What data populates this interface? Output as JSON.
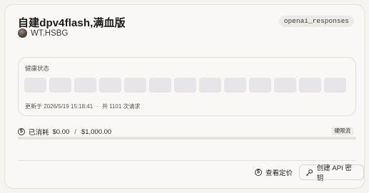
{
  "card": {
    "title": "自建dpv4flash,满血版",
    "tag": "openai_responses",
    "owner": "WT.HSBG"
  },
  "health": {
    "label": "健康状态",
    "bar_count": 13,
    "updated_label": "更新于 2026/5/19 15:18:41",
    "separator": "·",
    "request_summary": "共 1101 次请求"
  },
  "spend": {
    "icon": "dollar-circle-icon",
    "label": "已消耗",
    "spent": "$0.00",
    "divider": "/",
    "limit": "$1,000.00",
    "limit_type": "硬限流",
    "progress_fraction": 0.0
  },
  "actions": {
    "pricing_label": "查看定价",
    "create_key_label": "创建 API 密钥"
  }
}
